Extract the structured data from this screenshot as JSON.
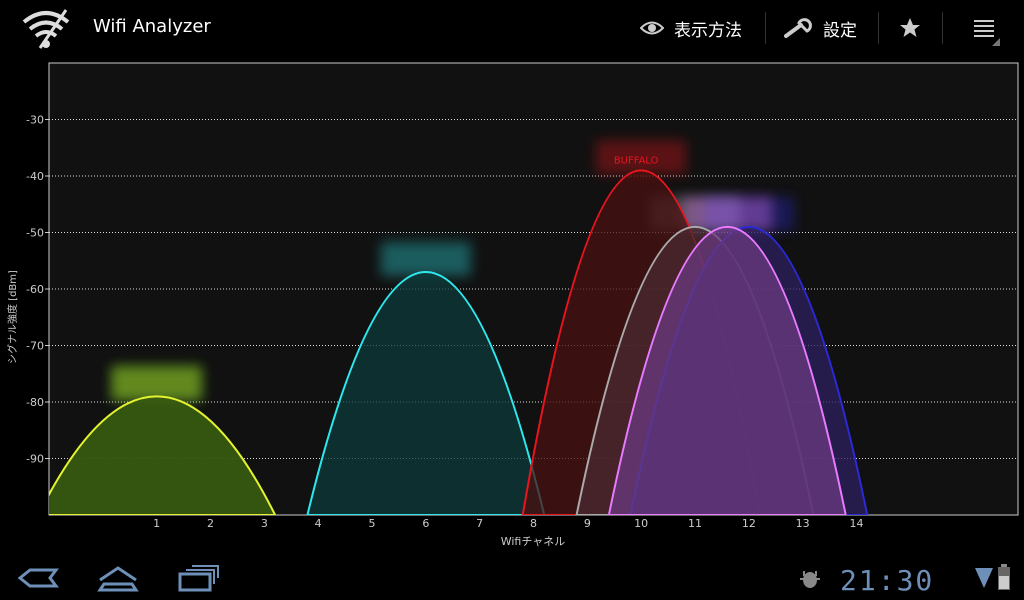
{
  "app": {
    "title": "Wifi Analyzer",
    "icon": "wifi-signal-icon"
  },
  "actionbar": {
    "view_label": "表示方法",
    "view_icon": "eye-icon",
    "settings_label": "設定",
    "settings_icon": "wrench-icon",
    "favorite_icon": "star-icon",
    "menu_icon": "overflow-menu-icon"
  },
  "statusbar": {
    "clock": "21:30",
    "back_icon": "back-icon",
    "home_icon": "home-icon",
    "recent_icon": "recent-apps-icon",
    "debug_icon": "android-debug-icon",
    "wifi_icon": "wifi-status-icon",
    "battery_icon": "battery-icon"
  },
  "chart_data": {
    "type": "area",
    "xlabel": "Wifiチャネル",
    "ylabel": "シグナル強度 [dBm]",
    "xticks": [
      1,
      2,
      3,
      4,
      5,
      6,
      7,
      8,
      9,
      10,
      11,
      12,
      13,
      14
    ],
    "yticks": [
      -30,
      -40,
      -50,
      -60,
      -70,
      -80,
      -90
    ],
    "xlim": [
      -1,
      17
    ],
    "ylim": [
      -100,
      -20
    ],
    "grid": true,
    "series": [
      {
        "name": "",
        "center": 1,
        "peak": -79,
        "stroke": "#2ecc1a",
        "fill": "#2f5a0f"
      },
      {
        "name": "",
        "center": 1,
        "peak": -79,
        "stroke": "#e8f030",
        "fill": "#3a5a10"
      },
      {
        "name": "",
        "center": 6,
        "peak": -57,
        "stroke": "#2ee8ee",
        "fill": "#0e3a3a"
      },
      {
        "name": "BUFFALO",
        "center": 10,
        "peak": -39,
        "stroke": "#e8141e",
        "fill": "#4a1010"
      },
      {
        "name": "",
        "center": 11,
        "peak": -49,
        "stroke": "#aaaaaa",
        "fill": "#4a2a30"
      },
      {
        "name": "",
        "center": 12,
        "peak": -49,
        "stroke": "#2a2ad8",
        "fill": "#2e2060"
      },
      {
        "name": "",
        "center": 11.6,
        "peak": -49,
        "stroke": "#e87aff",
        "fill": "#6a3a80"
      }
    ]
  }
}
